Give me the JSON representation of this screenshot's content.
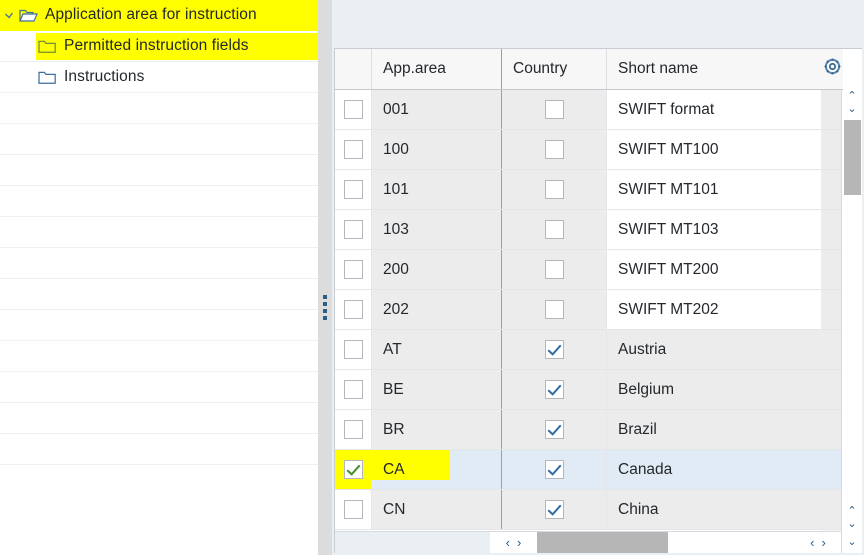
{
  "tree": {
    "items": [
      {
        "label": "Application area for instruction",
        "icon": "open-folder-icon",
        "expanded": true,
        "highlighted": true,
        "indent": 0,
        "truncated": true
      },
      {
        "label": "Permitted instruction fields",
        "icon": "folder-icon",
        "expanded": false,
        "highlighted": true,
        "indent": 1
      },
      {
        "label": "Instructions",
        "icon": "folder-icon",
        "expanded": false,
        "highlighted": false,
        "indent": 1
      }
    ],
    "empty_row_count": 12,
    "highlight_color": "#ffff00"
  },
  "splitter": {
    "name": "panel-splitter",
    "grip_dots": 4
  },
  "table": {
    "columns": [
      {
        "key": "select",
        "label": ""
      },
      {
        "key": "app_area",
        "label": "App.area"
      },
      {
        "key": "country",
        "label": "Country"
      },
      {
        "key": "short_name",
        "label": "Short name"
      }
    ],
    "settings_icon": "gear-icon",
    "rows": [
      {
        "select": false,
        "app_area": "001",
        "country": false,
        "short_name": "SWIFT format",
        "selected": false,
        "is_country": false
      },
      {
        "select": false,
        "app_area": "100",
        "country": false,
        "short_name": "SWIFT MT100",
        "selected": false,
        "is_country": false
      },
      {
        "select": false,
        "app_area": "101",
        "country": false,
        "short_name": "SWIFT MT101",
        "selected": false,
        "is_country": false
      },
      {
        "select": false,
        "app_area": "103",
        "country": false,
        "short_name": "SWIFT MT103",
        "selected": false,
        "is_country": false
      },
      {
        "select": false,
        "app_area": "200",
        "country": false,
        "short_name": "SWIFT MT200",
        "selected": false,
        "is_country": false
      },
      {
        "select": false,
        "app_area": "202",
        "country": false,
        "short_name": "SWIFT MT202",
        "selected": false,
        "is_country": false
      },
      {
        "select": false,
        "app_area": "AT",
        "country": true,
        "short_name": "Austria",
        "selected": false,
        "is_country": true
      },
      {
        "select": false,
        "app_area": "BE",
        "country": true,
        "short_name": "Belgium",
        "selected": false,
        "is_country": true
      },
      {
        "select": false,
        "app_area": "BR",
        "country": true,
        "short_name": "Brazil",
        "selected": false,
        "is_country": true
      },
      {
        "select": true,
        "app_area": "CA",
        "country": true,
        "short_name": "Canada",
        "selected": true,
        "is_country": true,
        "highlighted": true
      },
      {
        "select": false,
        "app_area": "CN",
        "country": true,
        "short_name": "China",
        "selected": false,
        "is_country": true
      }
    ]
  },
  "scrollbars": {
    "vertical": {
      "up_glyph": "⌃",
      "down_glyph": "⌄"
    },
    "horizontal": {
      "left_glyph": "‹",
      "right_glyph": "›"
    }
  },
  "colors": {
    "highlight": "#ffff00",
    "row_selected": "#e1ebf5",
    "cell_gray": "#ececec",
    "panel_bg": "#eaeff4",
    "check_blue": "#2e6ca4",
    "check_green": "#3f8f27"
  }
}
